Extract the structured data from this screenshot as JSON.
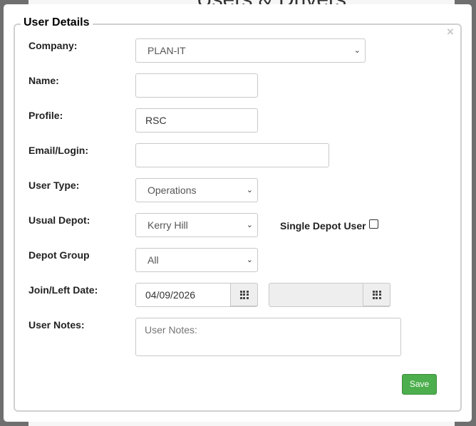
{
  "background": {
    "page_title": "Users & Drivers"
  },
  "dialog": {
    "legend": "User Details",
    "close_symbol": "×",
    "fields": {
      "company": {
        "label": "Company:",
        "value": "PLAN-IT"
      },
      "name": {
        "label": "Name:",
        "value": ""
      },
      "profile": {
        "label": "Profile:",
        "value": "RSC"
      },
      "email": {
        "label": "Email/Login:",
        "value": ""
      },
      "user_type": {
        "label": "User Type:",
        "value": "Operations"
      },
      "usual_depot": {
        "label": "Usual Depot:",
        "value": "Kerry Hill"
      },
      "single_depot": {
        "label": "Single Depot User",
        "checked": false
      },
      "depot_group": {
        "label": "Depot Group",
        "value": "All"
      },
      "join_left": {
        "label": "Join/Left Date:",
        "join_date": "04/09/2026",
        "left_date": ""
      },
      "notes": {
        "label": "User Notes:",
        "placeholder": "User Notes:",
        "value": ""
      }
    },
    "save_label": "Save"
  },
  "icons": {
    "calendar": "grid-icon",
    "chevron": "chevron-down-icon",
    "close": "close-icon"
  },
  "colors": {
    "save_button": "#4cae4c",
    "overlay": "#6f6f6f",
    "addon": "#eeeeee"
  }
}
